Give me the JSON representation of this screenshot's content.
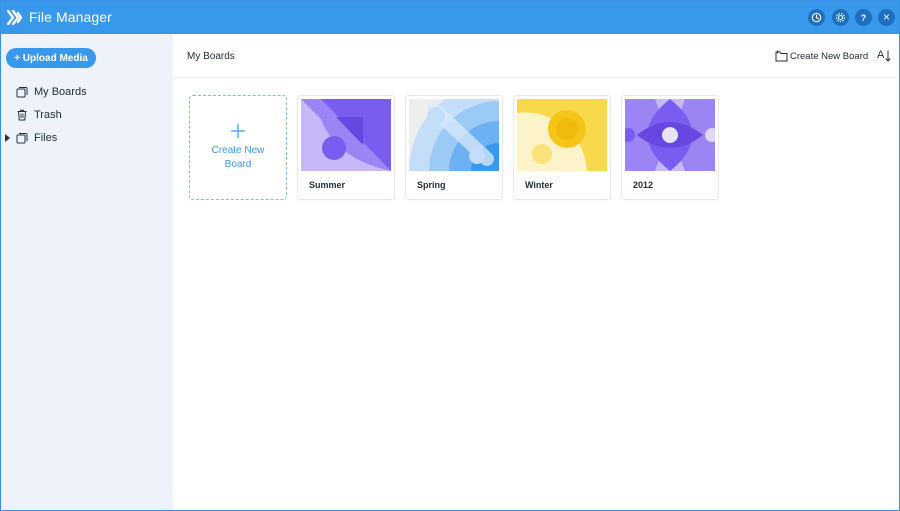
{
  "app": {
    "title": "File Manager"
  },
  "titlebar": {
    "buttons": [
      "clock-icon",
      "gear-icon",
      "help-icon",
      "close-icon"
    ],
    "help_text": "?",
    "close_text": "×"
  },
  "sidebar": {
    "upload_label": "+ Upload Media",
    "items": [
      {
        "label": "My Boards",
        "icon": "boards-icon"
      },
      {
        "label": "Trash",
        "icon": "trash-icon"
      },
      {
        "label": "Files",
        "icon": "files-icon"
      }
    ]
  },
  "main": {
    "breadcrumb": "My Boards",
    "create_board_label": "Create New Board",
    "sort_label": "A",
    "new_board_tile": "Create New Board",
    "boards": [
      {
        "name": "Summer"
      },
      {
        "name": "Spring"
      },
      {
        "name": "Winter"
      },
      {
        "name": "2012"
      }
    ]
  },
  "colors": {
    "accent": "#3899ec",
    "titlebar_button": "#1e6fc1",
    "sidebar_bg": "#eef3fb",
    "summer": "#7b5cf0",
    "spring": "#3899ec",
    "winter": "#f5c518",
    "year2012": "#7b5cf0"
  }
}
